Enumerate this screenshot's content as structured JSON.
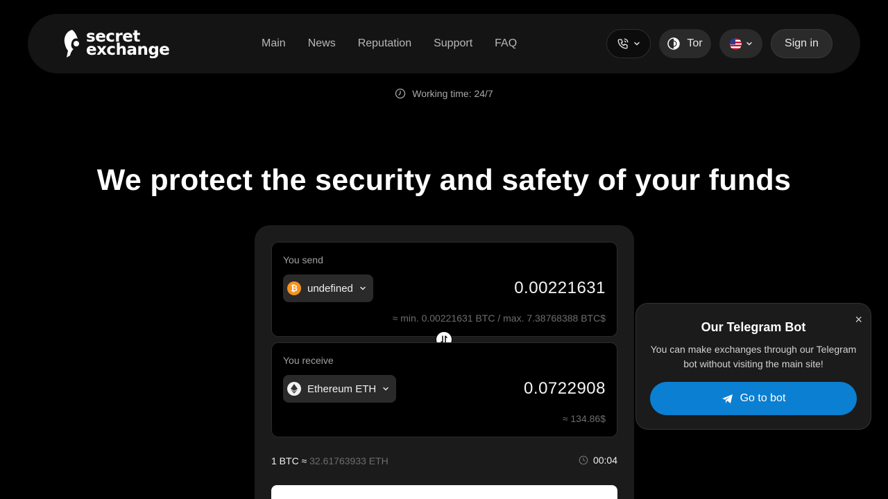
{
  "brand": {
    "line1": "secret",
    "line2": "exchange"
  },
  "nav": [
    {
      "label": "Main"
    },
    {
      "label": "News"
    },
    {
      "label": "Reputation"
    },
    {
      "label": "Support"
    },
    {
      "label": "FAQ"
    }
  ],
  "header_buttons": {
    "tor_label": "Tor",
    "signin_label": "Sign in",
    "language_flag": "us-flag-icon"
  },
  "working_time": "Working time: 24/7",
  "hero_title": "We protect the security and safety of your funds",
  "exchange": {
    "send": {
      "label": "You send",
      "coin_label": "undefined",
      "amount": "0.00221631",
      "limits": "≈ min. 0.00221631 BTC / max. 7.38768388 BTC$"
    },
    "receive": {
      "label": "You receive",
      "coin_label": "Ethereum ETH",
      "amount": "0.0722908",
      "usd_value": "≈ 134.86$"
    },
    "rate_left": "1 BTC ≈",
    "rate_right": "32.61763933 ETH",
    "timer": "00:04"
  },
  "telegram_popup": {
    "title": "Our Telegram Bot",
    "text": "You can make exchanges through our Telegram bot without visiting the main site!",
    "button_label": "Go to bot",
    "close_symbol": "×"
  },
  "colors": {
    "accent_blue": "#0b7fd1",
    "btc_orange": "#f7931a",
    "background": "#000000",
    "panel": "#1b1b1b"
  }
}
